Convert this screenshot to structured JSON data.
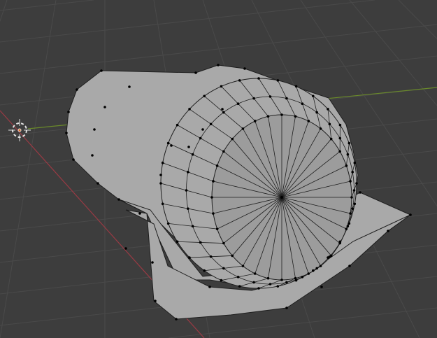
{
  "viewport": {
    "background_color": "#3d3d3d",
    "grid_color": "#4a4a4a",
    "x_axis_color": "#9a3a44",
    "y_axis_color": "#6a8a2a",
    "mesh_color": "#a9a9a9",
    "edge_color": "#1e1e1e",
    "vertex_color": "#000000",
    "cursor_color": "#e0e0e0",
    "cursor_center_color": "#e07020"
  },
  "mesh": {
    "spoke_count": 32,
    "ring_count": 3
  }
}
